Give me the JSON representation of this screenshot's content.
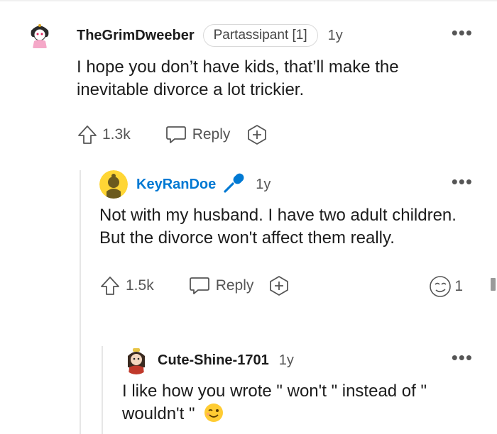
{
  "comments": [
    {
      "author": "TheGrimDweeber",
      "flair": "Partassipant [1]",
      "age": "1y",
      "text": "I hope you don’t have kids, that’ll make the inevitable divorce a lot trickier.",
      "upvotes": "1.3k",
      "reply_label": "Reply"
    },
    {
      "author": "KeyRanDoe",
      "age": "1y",
      "text": "Not with my husband. I have two adult children. But the divorce won't affect them really.",
      "upvotes": "1.5k",
      "reply_label": "Reply",
      "award_count": "1"
    },
    {
      "author": "Cute-Shine-1701",
      "age": "1y",
      "text": "I like how you wrote \" won't \" instead of \" wouldn't \""
    }
  ],
  "colors": {
    "op_author": "#0079d3",
    "text": "#1c1c1c",
    "muted": "#555555"
  },
  "icons": [
    "avatar",
    "op-microphone-icon",
    "upvote-icon",
    "reply-icon",
    "award-plus-icon",
    "award-emoji-icon",
    "wink-emoji-icon",
    "more-options-icon"
  ]
}
